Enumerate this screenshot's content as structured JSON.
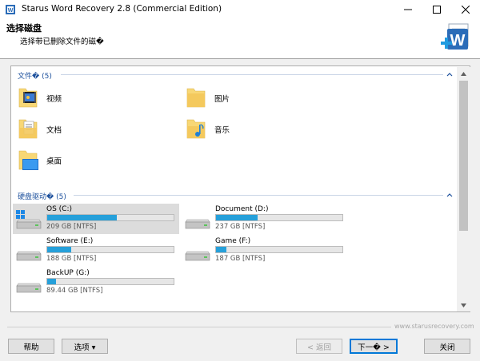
{
  "window": {
    "title": "Starus Word Recovery 2.8 (Commercial Edition)"
  },
  "header": {
    "title": "选择磁盘",
    "subtitle": "选择带已删除文件的磁�"
  },
  "folders_section": {
    "label": "文件� (5)",
    "items": [
      {
        "label": "视频",
        "icon": "video-folder-icon"
      },
      {
        "label": "图片",
        "icon": "pictures-folder-icon"
      },
      {
        "label": "文档",
        "icon": "documents-folder-icon"
      },
      {
        "label": "音乐",
        "icon": "music-folder-icon"
      },
      {
        "label": "桌面",
        "icon": "desktop-folder-icon"
      }
    ]
  },
  "drives_section": {
    "label": "硬盘驱动� (5)",
    "items": [
      {
        "name": "OS (C:)",
        "info": "209 GB [NTFS]",
        "used_fraction": 0.55,
        "selected": true
      },
      {
        "name": "Document (D:)",
        "info": "237 GB [NTFS]",
        "used_fraction": 0.33,
        "selected": false
      },
      {
        "name": "Software (E:)",
        "info": "188 GB [NTFS]",
        "used_fraction": 0.19,
        "selected": false
      },
      {
        "name": "Game (F:)",
        "info": "187 GB [NTFS]",
        "used_fraction": 0.08,
        "selected": false
      },
      {
        "name": "BackUP (G:)",
        "info": "89.44 GB [NTFS]",
        "used_fraction": 0.07,
        "selected": false
      }
    ]
  },
  "footer": {
    "website": "www.starusrecovery.com",
    "help": "帮助",
    "options": "选项 ▾",
    "back": "< 返回",
    "next": "下一� >",
    "close": "关闭"
  },
  "colors": {
    "accent": "#26a0da",
    "section_text": "#1b4f9c",
    "folder_yellow": "#f8d775"
  }
}
